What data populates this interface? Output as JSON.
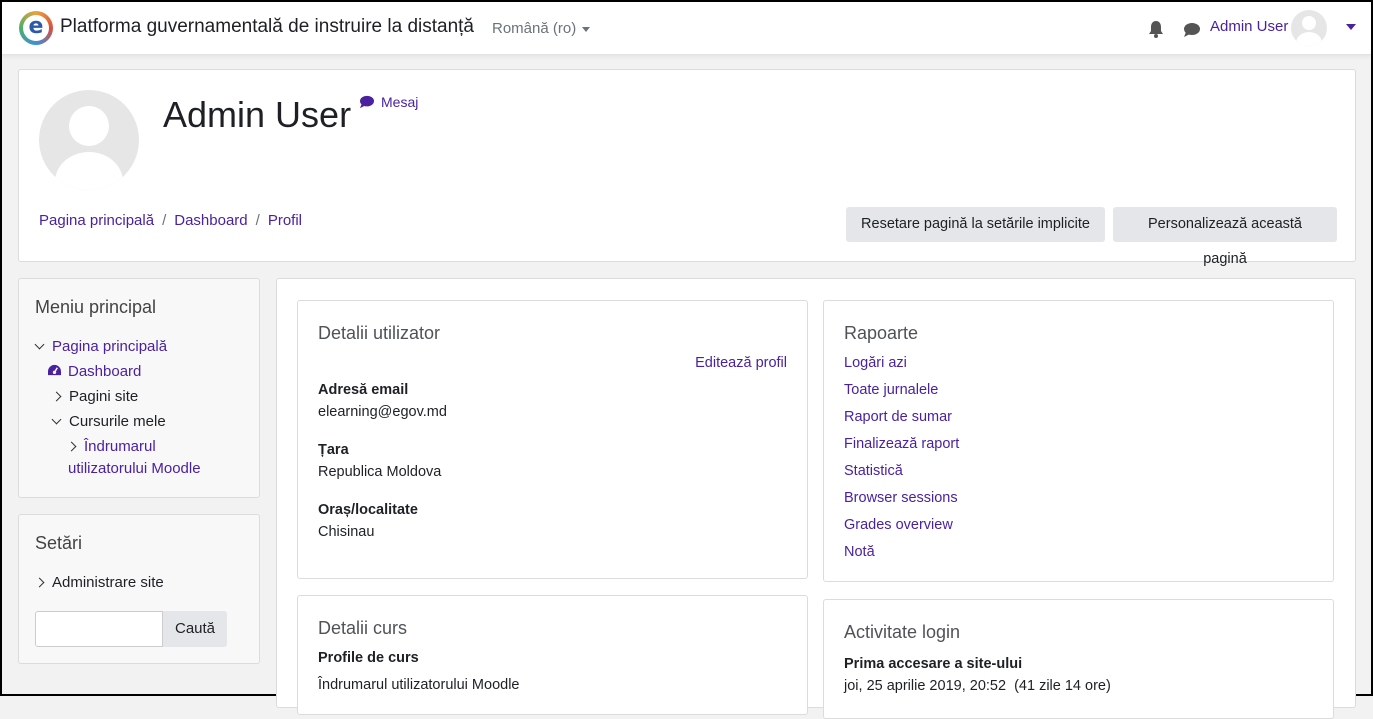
{
  "navbar": {
    "logo_letter": "e",
    "site_title": "Platforma guvernamentală de instruire la distanță",
    "language": "Română (ro)",
    "user_name": "Admin User"
  },
  "header": {
    "title": "Admin User",
    "message_link": "Mesaj",
    "breadcrumb": [
      "Pagina principală",
      "Dashboard",
      "Profil"
    ],
    "breadcrumb_separator": "/",
    "reset_button": "Resetare pagină la setările implicite",
    "customize_button": "Personalizează această pagină"
  },
  "sidebar": {
    "main_menu": {
      "title": "Meniu principal",
      "items": [
        {
          "label": "Pagina principală"
        },
        {
          "label": "Dashboard"
        },
        {
          "label": "Pagini site"
        },
        {
          "label": "Cursurile mele"
        },
        {
          "label_line1": "Îndrumarul",
          "label_line2": "utilizatorului Moodle"
        }
      ]
    },
    "settings": {
      "title": "Setări",
      "items": [
        {
          "label": "Administrare site"
        }
      ],
      "search_placeholder": "",
      "search_button": "Caută"
    }
  },
  "user_details": {
    "title": "Detalii utilizator",
    "edit_link": "Editează profil",
    "fields": [
      {
        "label": "Adresă email",
        "value": "elearning@egov.md"
      },
      {
        "label": "Țara",
        "value": "Republica Moldova"
      },
      {
        "label": "Oraș/localitate",
        "value": "Chisinau"
      }
    ]
  },
  "course_details": {
    "title": "Detalii curs",
    "label": "Profile de curs",
    "course_link": "Îndrumarul utilizatorului Moodle"
  },
  "reports": {
    "title": "Rapoarte",
    "links": [
      "Logări azi",
      "Toate jurnalele",
      "Raport de sumar",
      "Finalizează raport",
      "Statistică",
      "Browser sessions",
      "Grades overview",
      "Notă"
    ]
  },
  "login_activity": {
    "title": "Activitate login",
    "first_access_label": "Prima accesare a site-ului",
    "first_access_value": "joi, 25 aprilie 2019, 20:52  (41 zile 14 ore)"
  },
  "colors": {
    "accent": "#4a22a0",
    "button_bg": "#e4e6e9",
    "page_bg": "#f2f2f2"
  }
}
